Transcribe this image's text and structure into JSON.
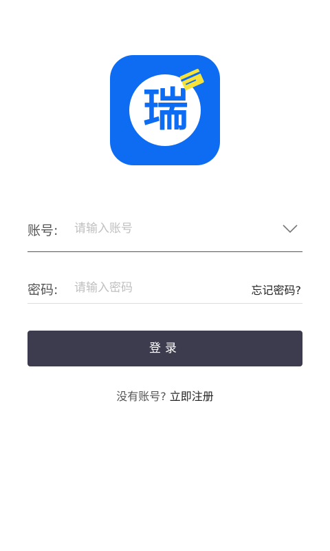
{
  "logo": {
    "char": "瑞",
    "background_color": "#0d6cf2",
    "accent_color": "#f5e33a"
  },
  "account": {
    "label": "账号:",
    "placeholder": "请输入账号",
    "value": ""
  },
  "password": {
    "label": "密码:",
    "placeholder": "请输入密码",
    "value": "",
    "forgot_label": "忘记密码?"
  },
  "login_button": {
    "label": "登录",
    "color": "#3c3c4e"
  },
  "register": {
    "prompt": "没有账号? ",
    "link_label": "立即注册"
  }
}
